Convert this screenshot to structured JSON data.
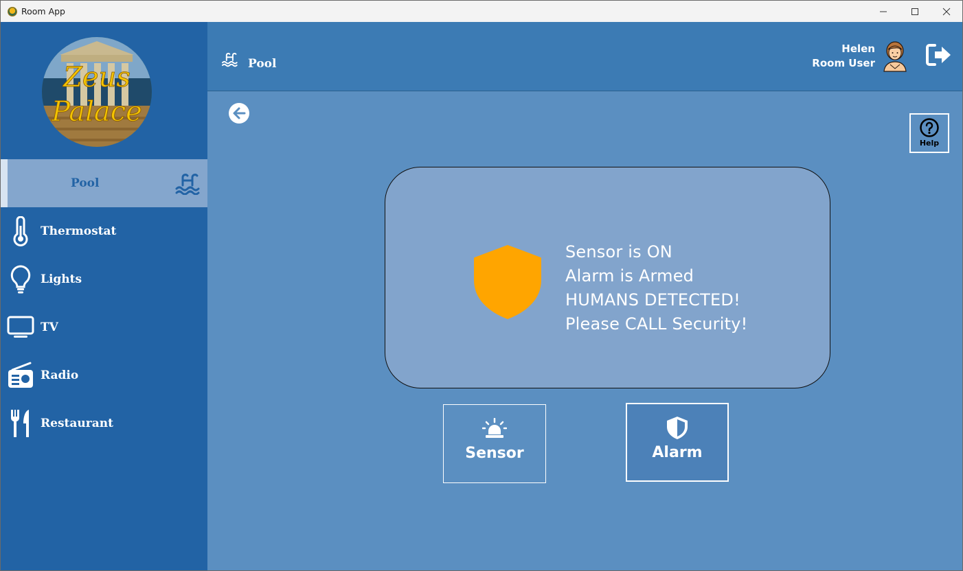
{
  "window": {
    "title": "Room App",
    "controls": {
      "minimize": "—",
      "maximize": "☐",
      "close": "✕"
    }
  },
  "sidebar": {
    "logo_text": [
      "Zeus",
      "Palace"
    ],
    "items": [
      {
        "label": "Pool",
        "icon": "pool-icon",
        "active": true
      },
      {
        "label": "Thermostat",
        "icon": "thermometer-icon"
      },
      {
        "label": "Lights",
        "icon": "lightbulb-icon"
      },
      {
        "label": "TV",
        "icon": "tv-icon"
      },
      {
        "label": "Radio",
        "icon": "radio-icon"
      },
      {
        "label": "Restaurant",
        "icon": "utensils-icon"
      }
    ]
  },
  "header": {
    "title": "Pool",
    "icon": "pool-icon",
    "user": {
      "name": "Helen",
      "role": "Room User"
    },
    "logout_icon": "logout-icon"
  },
  "main": {
    "back_icon": "arrow-left-icon",
    "help": {
      "label": "Help",
      "icon": "question-circle-icon"
    },
    "status": {
      "icon": "shield-icon",
      "icon_color": "#ffa500",
      "lines": [
        "Sensor is ON",
        "Alarm is Armed",
        "HUMANS DETECTED!",
        "Please CALL Security!"
      ]
    },
    "buttons": {
      "sensor": {
        "label": "Sensor",
        "icon": "siren-icon"
      },
      "alarm": {
        "label": "Alarm",
        "icon": "shield-half-icon"
      }
    }
  },
  "colors": {
    "sidebar": "#2263a5",
    "header": "#3c7bb4",
    "content": "#5b8fc1",
    "card": "#82a4cc",
    "active_item": "#84a6cd"
  }
}
